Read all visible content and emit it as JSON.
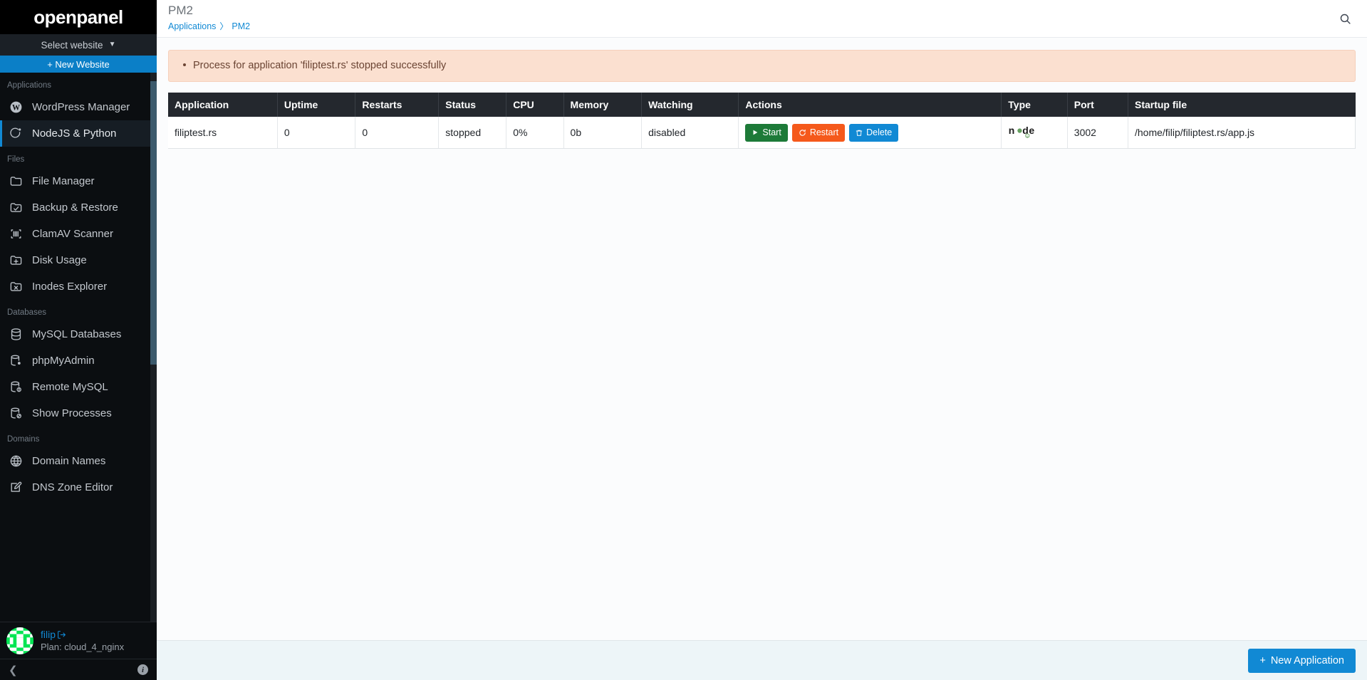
{
  "sidebar": {
    "brand": "openpanel",
    "site_select_label": "Select website",
    "new_website_label": "+ New Website",
    "sections": [
      {
        "label": "Applications",
        "items": [
          {
            "label": "WordPress Manager",
            "icon": "wordpress-icon",
            "active": false
          },
          {
            "label": "NodeJS & Python",
            "icon": "nodejs-python-icon",
            "active": true
          }
        ]
      },
      {
        "label": "Files",
        "items": [
          {
            "label": "File Manager",
            "icon": "folder-icon",
            "active": false
          },
          {
            "label": "Backup & Restore",
            "icon": "folder-check-icon",
            "active": false
          },
          {
            "label": "ClamAV Scanner",
            "icon": "scanner-icon",
            "active": false
          },
          {
            "label": "Disk Usage",
            "icon": "folder-plus-icon",
            "active": false
          },
          {
            "label": "Inodes Explorer",
            "icon": "folder-x-icon",
            "active": false
          }
        ]
      },
      {
        "label": "Databases",
        "items": [
          {
            "label": "MySQL Databases",
            "icon": "database-icon",
            "active": false
          },
          {
            "label": "phpMyAdmin",
            "icon": "database-dot-icon",
            "active": false
          },
          {
            "label": "Remote MySQL",
            "icon": "database-info-icon",
            "active": false
          },
          {
            "label": "Show Processes",
            "icon": "database-ban-icon",
            "active": false
          }
        ]
      },
      {
        "label": "Domains",
        "items": [
          {
            "label": "Domain Names",
            "icon": "globe-icon",
            "active": false
          },
          {
            "label": "DNS Zone Editor",
            "icon": "edit-square-icon",
            "active": false
          }
        ]
      }
    ],
    "user": {
      "name": "filip",
      "plan": "Plan: cloud_4_nginx",
      "logout_icon": "logout-icon",
      "avatar_icon": "avatar-identicon"
    },
    "footer": {
      "collapse_icon": "chevron-left-icon",
      "info_icon": "info-icon"
    }
  },
  "header": {
    "title": "PM2",
    "breadcrumb": {
      "parent": "Applications",
      "separator": "〉",
      "current": "PM2"
    },
    "search_icon": "search-icon"
  },
  "alert": {
    "message": "Process for application 'filiptest.rs' stopped successfully"
  },
  "table": {
    "columns": [
      "Application",
      "Uptime",
      "Restarts",
      "Status",
      "CPU",
      "Memory",
      "Watching",
      "Actions",
      "Type",
      "Port",
      "Startup file"
    ],
    "rows": [
      {
        "application": "filiptest.rs",
        "uptime": "0",
        "restarts": "0",
        "status": "stopped",
        "cpu": "0%",
        "memory": "0b",
        "watching": "disabled",
        "actions": [
          {
            "label": "Start",
            "icon": "play-icon",
            "style": "start"
          },
          {
            "label": "Restart",
            "icon": "refresh-icon",
            "style": "restart"
          },
          {
            "label": "Delete",
            "icon": "trash-icon",
            "style": "delete"
          }
        ],
        "type": "node-logo-icon",
        "port": "3002",
        "startup_file": "/home/filip/filiptest.rs/app.js"
      }
    ]
  },
  "footer": {
    "new_application_label": "New Application",
    "plus_icon": "plus-icon"
  },
  "colors": {
    "accent": "#1189d4",
    "start": "#1d7a38",
    "restart": "#f5591b",
    "delete": "#1189d4",
    "status_stopped": "#e8201a",
    "alert_bg": "#fbe0d0",
    "table_header_bg": "#24282e",
    "sidebar_bg": "#0b0e11"
  }
}
